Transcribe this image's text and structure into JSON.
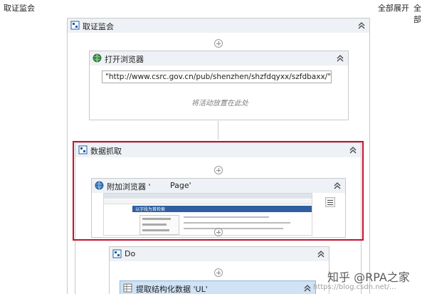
{
  "topbar": {
    "title": "取证监会",
    "expand_all": "全部展开",
    "collapse_all": "全部"
  },
  "sequence": {
    "title": "取证监会"
  },
  "open_browser": {
    "title": "打开浏览器",
    "url_value": "\"http://www.csrc.gov.cn/pub/shenzhen/shzfdqyxx/szfdbaxx/\"",
    "drop_hint": "将活动放置在此处"
  },
  "data_scraping": {
    "title": "数据抓取"
  },
  "attach_browser": {
    "title": "附加浏览器 '",
    "title_suffix": "Page'",
    "thumbnail_text": "以字段为首检索"
  },
  "do_block": {
    "title": "Do"
  },
  "extract": {
    "title": "提取结构化数据 'UL'"
  },
  "watermark": {
    "main": "知乎 @RPA之家",
    "sub": "https://blog.csdn.net/..."
  },
  "colors": {
    "highlight": "#c8102e",
    "header_bg": "#eef1f5"
  }
}
